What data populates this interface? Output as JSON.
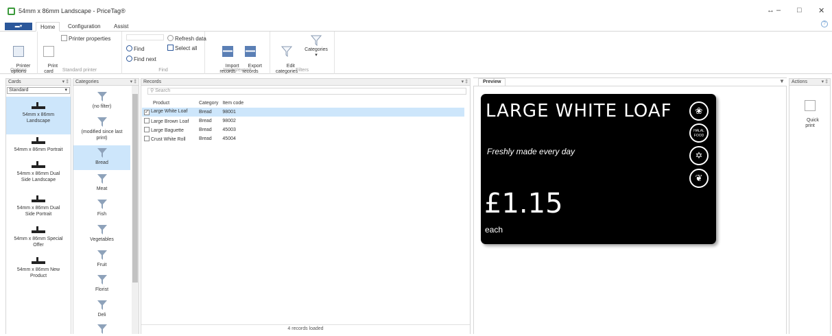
{
  "window": {
    "title": "54mm x 86mm Landscape - PriceTag®",
    "controls": [
      "↔",
      "–",
      "□",
      "✕"
    ]
  },
  "ribbon_tabs": [
    "Home",
    "Configuration",
    "Assist"
  ],
  "ribbon": {
    "options": {
      "printer_options": "Printer\noptions",
      "group": "Options"
    },
    "standard_printer": {
      "print_card": "Print\ncard",
      "printer_properties": "Printer properties",
      "group": "Standard printer"
    },
    "find": {
      "find": "Find",
      "find_next": "Find next",
      "refresh": "Refresh data",
      "select_all": "Select all",
      "group": "Find"
    },
    "import_export": {
      "import": "Import\nrecords",
      "export": "Export\nrecords",
      "group": "Import/export"
    },
    "filters": {
      "edit": "Edit\ncategories",
      "categories": "Categories",
      "group": "Filters"
    }
  },
  "cards_panel": {
    "header": "Cards",
    "dropdown": "Standard",
    "items": [
      "54mm x 86mm Landscape",
      "54mm x 86mm Portrait",
      "54mm x 86mm Dual Side Landscape",
      "54mm x 86mm Dual Side Portrait",
      "54mm x 86mm Special Offer",
      "54mm x 86mm New Product"
    ]
  },
  "categories_panel": {
    "header": "Categories",
    "items": [
      "(no filter)",
      "(modified since last print)",
      "Bread",
      "Meat",
      "Fish",
      "Vegetables",
      "Fruit",
      "Florist",
      "Deli"
    ]
  },
  "records_panel": {
    "header": "Records",
    "search_placeholder": "Search",
    "columns": [
      "Product",
      "Category",
      "Item code"
    ],
    "rows": [
      {
        "product": "Large White Loaf",
        "category": "Bread",
        "code": "98001",
        "checked": "✓"
      },
      {
        "product": "Large Brown Loaf",
        "category": "Bread",
        "code": "98002",
        "checked": ""
      },
      {
        "product": "Large Baguette",
        "category": "Bread",
        "code": "45003",
        "checked": ""
      },
      {
        "product": "Crust White Roll",
        "category": "Bread",
        "code": "45004",
        "checked": ""
      }
    ],
    "status": "4 records loaded"
  },
  "preview_panel": {
    "header": "Preview",
    "label": {
      "title": "LARGE WHITE LOAF",
      "subtitle": "Freshly made every day",
      "price": "£1.15",
      "unit": "each",
      "badge_halal": "HALAL FOOD"
    }
  },
  "actions_panel": {
    "header": "Actions",
    "quick_print": "Quick\nprint"
  },
  "colors": {
    "accent": "#2b579a",
    "selection": "#cde6fb"
  }
}
